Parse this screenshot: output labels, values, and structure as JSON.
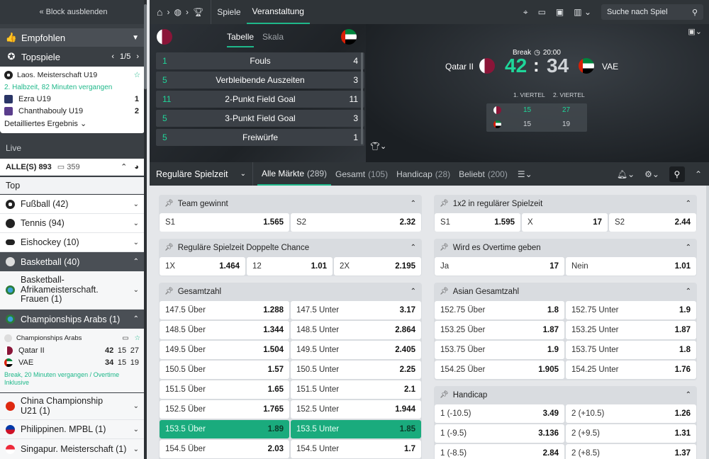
{
  "sidebar": {
    "hide_label": "« Block ausblenden",
    "recommended": "Empfohlen",
    "top_games": "Topspiele",
    "top_pager": "1/5",
    "feature": {
      "league": "Laos. Meisterschaft U19",
      "status": "2. Halbzeit, 82 Minuten vergangen",
      "team1": "Ezra U19",
      "score1": "1",
      "team2": "Chanthabouly U19",
      "score2": "2",
      "details": "Detailliertes Ergebnis"
    },
    "live_label": "Live",
    "all_label": "ALLE(S) 893",
    "all_count": "359",
    "top_label": "Top",
    "sports": [
      {
        "label": "Fußball (42)",
        "color": "#222"
      },
      {
        "label": "Tennis (94)",
        "color": "#222"
      },
      {
        "label": "Eishockey (10)",
        "color": "#222"
      },
      {
        "label": "Basketball (40)",
        "color": "#fff"
      }
    ],
    "leagues": [
      {
        "label": "Basketball-Afrikameisterschaft. Frauen (1)"
      },
      {
        "label": "Championships Arabs (1)"
      }
    ],
    "live_match": {
      "league": "Championships Arabs",
      "team1": "Qatar II",
      "t1_total": "42",
      "t1_q1": "15",
      "t1_q2": "27",
      "team2": "VAE",
      "t2_total": "34",
      "t2_q1": "15",
      "t2_q2": "19",
      "status": "Break, 20 Minuten vergangen / Overtime Inklusive"
    },
    "more_leagues": [
      {
        "label": "China Championship U21 (1)"
      },
      {
        "label": "Philippinen. MPBL (1)"
      },
      {
        "label": "Singapur. Meisterschaft (1)"
      }
    ]
  },
  "topbar": {
    "tab_games": "Spiele",
    "tab_event": "Veranstaltung",
    "search_placeholder": "Suche nach Spiel"
  },
  "stats": {
    "tab_table": "Tabelle",
    "tab_scale": "Skala",
    "rows": [
      {
        "left": "1",
        "label": "Fouls",
        "right": "4"
      },
      {
        "left": "5",
        "label": "Verbleibende Auszeiten",
        "right": "3"
      },
      {
        "left": "11",
        "label": "2-Punkt Field Goal",
        "right": "11"
      },
      {
        "left": "5",
        "label": "3-Punkt Field Goal",
        "right": "3"
      },
      {
        "left": "5",
        "label": "Freiwürfe",
        "right": "1"
      }
    ]
  },
  "scoreboard": {
    "status": "Break",
    "time": "20:00",
    "team1": "Qatar II",
    "team2": "VAE",
    "score1": "42",
    "score2": "34",
    "q1_label": "1. VIERTEL",
    "q2_label": "2. VIERTEL",
    "t1_q1": "15",
    "t1_q2": "27",
    "t2_q1": "15",
    "t2_q2": "19"
  },
  "betting": {
    "period": "Reguläre Spielzeit",
    "tabs": [
      {
        "label": "Alle Märkte",
        "count": "(289)"
      },
      {
        "label": "Gesamt",
        "count": "(105)"
      },
      {
        "label": "Handicap",
        "count": "(28)"
      },
      {
        "label": "Beliebt",
        "count": "(200)"
      }
    ]
  },
  "markets": {
    "team_wins": {
      "title": "Team gewinnt",
      "odds": [
        {
          "l": "S1",
          "v": "1.565"
        },
        {
          "l": "S2",
          "v": "2.32"
        }
      ]
    },
    "one_x_two": {
      "title": "1x2 in regulärer Spielzeit",
      "odds": [
        {
          "l": "S1",
          "v": "1.595"
        },
        {
          "l": "X",
          "v": "17"
        },
        {
          "l": "S2",
          "v": "2.44"
        }
      ]
    },
    "double": {
      "title": "Reguläre Spielzeit Doppelte Chance",
      "odds": [
        {
          "l": "1X",
          "v": "1.464"
        },
        {
          "l": "12",
          "v": "1.01"
        },
        {
          "l": "2X",
          "v": "2.195"
        }
      ]
    },
    "overtime": {
      "title": "Wird es Overtime geben",
      "odds": [
        {
          "l": "Ja",
          "v": "17"
        },
        {
          "l": "Nein",
          "v": "1.01"
        }
      ]
    },
    "total": {
      "title": "Gesamtzahl",
      "rows": [
        {
          "a": "147.5 Über",
          "av": "1.288",
          "b": "147.5 Unter",
          "bv": "3.17"
        },
        {
          "a": "148.5 Über",
          "av": "1.344",
          "b": "148.5 Unter",
          "bv": "2.864"
        },
        {
          "a": "149.5 Über",
          "av": "1.504",
          "b": "149.5 Unter",
          "bv": "2.405"
        },
        {
          "a": "150.5 Über",
          "av": "1.57",
          "b": "150.5 Unter",
          "bv": "2.25"
        },
        {
          "a": "151.5 Über",
          "av": "1.65",
          "b": "151.5 Unter",
          "bv": "2.1"
        },
        {
          "a": "152.5 Über",
          "av": "1.765",
          "b": "152.5 Unter",
          "bv": "1.944"
        },
        {
          "a": "153.5 Über",
          "av": "1.89",
          "b": "153.5 Unter",
          "bv": "1.85"
        },
        {
          "a": "154.5 Über",
          "av": "2.03",
          "b": "154.5 Unter",
          "bv": "1.7"
        }
      ]
    },
    "asian_total": {
      "title": "Asian Gesamtzahl",
      "rows": [
        {
          "a": "152.75 Über",
          "av": "1.8",
          "b": "152.75 Unter",
          "bv": "1.9"
        },
        {
          "a": "153.25 Über",
          "av": "1.87",
          "b": "153.25 Unter",
          "bv": "1.87"
        },
        {
          "a": "153.75 Über",
          "av": "1.9",
          "b": "153.75 Unter",
          "bv": "1.8"
        },
        {
          "a": "154.25 Über",
          "av": "1.905",
          "b": "154.25 Unter",
          "bv": "1.76"
        }
      ]
    },
    "handicap": {
      "title": "Handicap",
      "rows": [
        {
          "a": "1 (-10.5)",
          "av": "3.49",
          "b": "2 (+10.5)",
          "bv": "1.26"
        },
        {
          "a": "1 (-9.5)",
          "av": "3.136",
          "b": "2 (+9.5)",
          "bv": "1.31"
        },
        {
          "a": "1 (-8.5)",
          "av": "2.84",
          "b": "2 (+8.5)",
          "bv": "1.37"
        }
      ]
    }
  },
  "colors": {
    "accent": "#1fb88a",
    "highlight": "#1aab7d",
    "dark": "#2f3438"
  }
}
